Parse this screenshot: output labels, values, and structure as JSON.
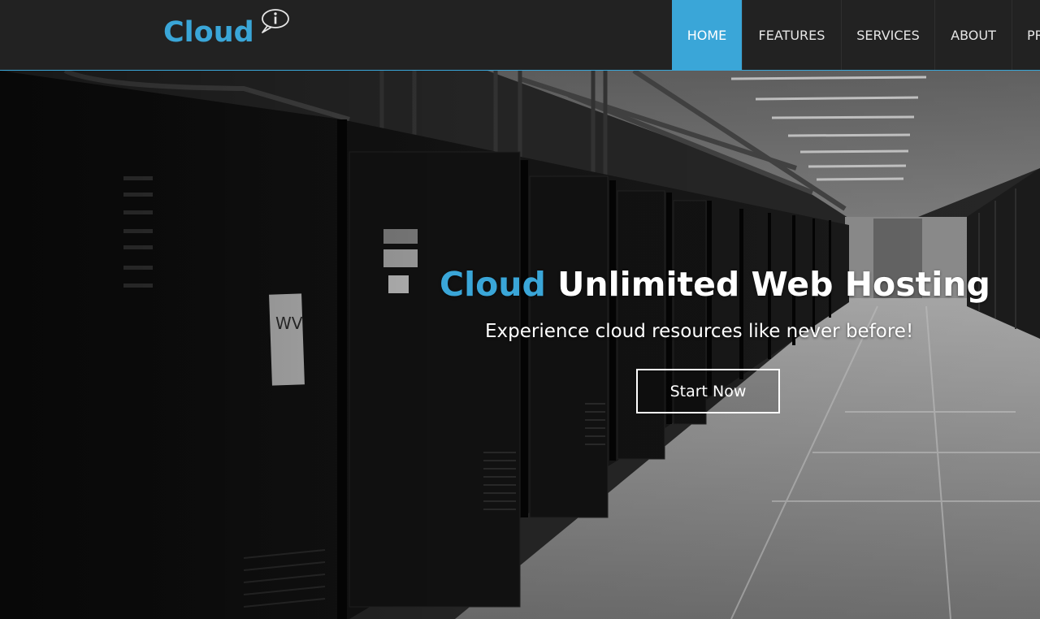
{
  "brand": {
    "name": "Cloud",
    "badge_icon": "info-speech-bubble-icon",
    "color": "#3aa6d8"
  },
  "nav": {
    "items": [
      {
        "label": "HOME",
        "active": true
      },
      {
        "label": "FEATURES",
        "active": false
      },
      {
        "label": "SERVICES",
        "active": false
      },
      {
        "label": "ABOUT",
        "active": false
      },
      {
        "label": "PRICING",
        "active": false
      }
    ],
    "active_color": "#3aa6d8"
  },
  "hero": {
    "title_accent": "Cloud",
    "title_rest": "Unlimited Web Hosting",
    "subtitle": "Experience cloud resources like never before!",
    "cta_label": "Start Now",
    "background": "data-center-server-racks-photo"
  }
}
